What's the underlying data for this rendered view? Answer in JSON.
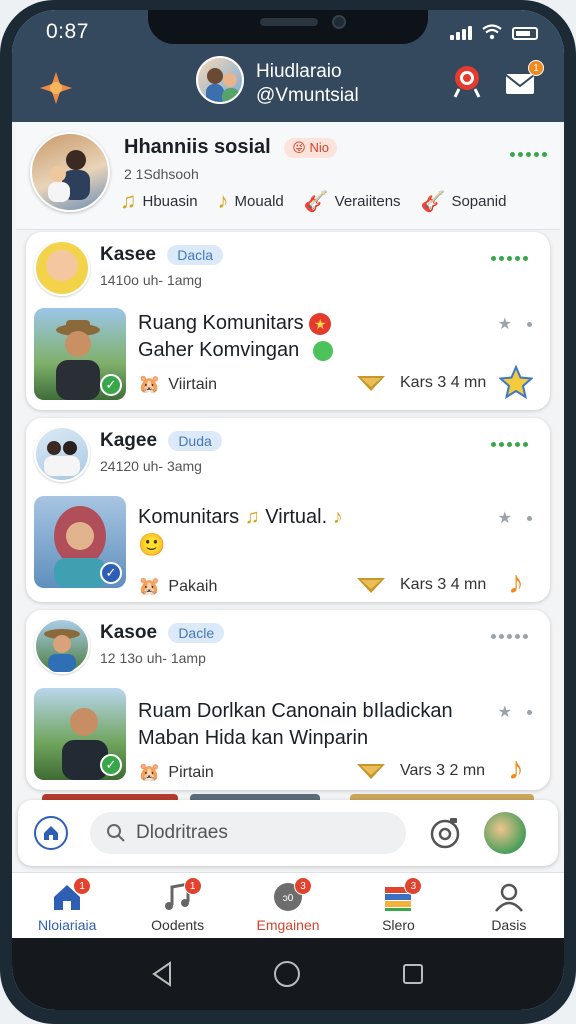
{
  "status": {
    "time": "0:87"
  },
  "header": {
    "title_line1": "Hiudlaraio",
    "title_line2": "@Vmuntsial",
    "notification_count": "1"
  },
  "profile": {
    "name": "Hhanniis sosial",
    "tag": "Nio",
    "subtitle": "2 1Sdhsooh",
    "chips": [
      "Hbuasin",
      "Mouald",
      "Veraiitens",
      "Sopanid"
    ]
  },
  "posts": [
    {
      "user": "Kasee",
      "tag": "Dacla",
      "meta": "1410o uh- 1amg",
      "line1": "Ruang Komunitars",
      "line2": "Gaher Komvingan",
      "foot_left": "Viirtain",
      "foot_mid": "Kars 3 4 mn"
    },
    {
      "user": "Kagee",
      "tag": "Duda",
      "meta": "24120 uh- 3amg",
      "line1": "Komunitars",
      "line1b": "Virtual.",
      "line2": "",
      "foot_left": "Pakaih",
      "foot_mid": "Kars 3 4 mn"
    },
    {
      "user": "Kasoe",
      "tag": "Dacle",
      "meta": "12 13o uh- 1amp",
      "line1": "Ruam Dorlkan Canonain bIladickan",
      "line2": "Maban Hida kan Winparin",
      "foot_left": "Pirtain",
      "foot_mid": "Vars 3 2 mn"
    }
  ],
  "search": {
    "placeholder": "Dlodritraes"
  },
  "tabs": [
    {
      "label": "Nloiariaia",
      "badge": "1",
      "active": true
    },
    {
      "label": "Oodents",
      "badge": "1"
    },
    {
      "label": "Emgainen",
      "badge": "3"
    },
    {
      "label": "Slero",
      "badge": "3"
    },
    {
      "label": "Dasis",
      "badge": ""
    }
  ],
  "colors": {
    "header": "#34495e",
    "accent_green": "#3aa64a",
    "accent_red": "#d2452c",
    "active_tab": "#2f5fb5"
  }
}
